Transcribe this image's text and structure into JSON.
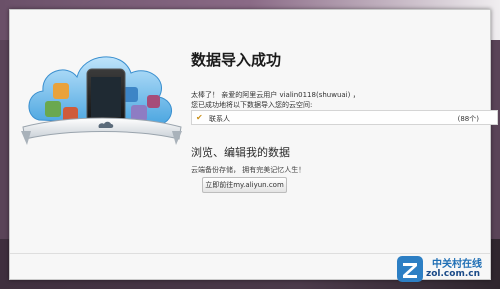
{
  "dialog": {
    "title": "数据导入成功",
    "message_line1": "太棒了！ 亲爱的阿里云用户 vialin0118(shuwuai) ，",
    "message_line2": "您已成功地将以下数据导入您的云空间:",
    "imported_item": {
      "label": "联系人",
      "count": "(88个)"
    },
    "subtitle": "浏览、编辑我的数据",
    "description": "云端备份存储， 拥有完美记忆人生！",
    "goto_button_label": "立即前往my.aliyun.com"
  },
  "watermark": {
    "name": "中关村在线",
    "url": "zol.com.cn"
  },
  "colors": {
    "accent_check": "#c98f1a",
    "brand_blue": "#1f6fb5"
  },
  "icons": [
    "cloud-illustration-icon",
    "phone-icon",
    "check-icon",
    "zol-logo-icon"
  ]
}
